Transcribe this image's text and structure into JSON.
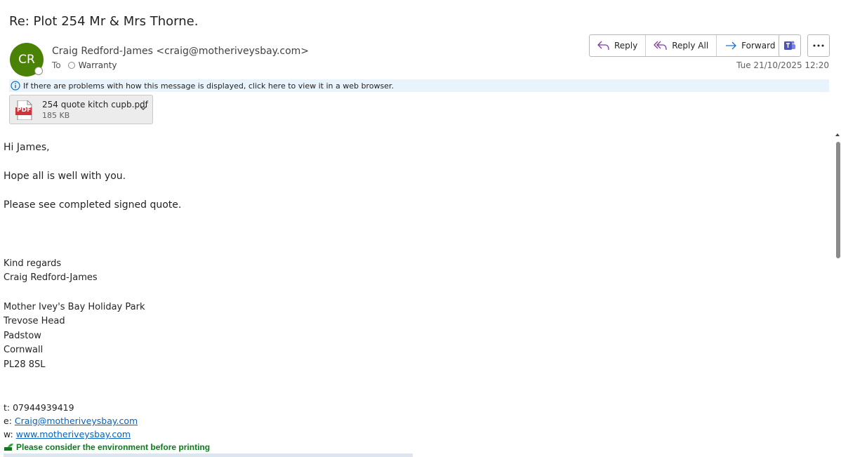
{
  "message": {
    "subject": "Re: Plot 254 Mr & Mrs Thorne.",
    "sender_initials": "CR",
    "sender": "Craig Redford-James <craig@motheriveysbay.com>",
    "to_label": "To",
    "recipient": "Warranty",
    "date": "Tue 21/10/2025 12:20",
    "info_bar": "If there are problems with how this message is displayed, click here to view it in a web browser."
  },
  "actions": {
    "reply": "Reply",
    "reply_all": "Reply All",
    "forward": "Forward"
  },
  "attachment": {
    "type_label": "PDF",
    "name": "254 quote kitch cupb.pdf",
    "size": "185 KB"
  },
  "body": {
    "greeting": "Hi James,",
    "line1": "Hope all is well with you.",
    "line2": "Please see completed signed quote."
  },
  "signature": {
    "sign_off": "Kind regards",
    "name": "Craig Redford-James",
    "address": [
      "Mother Ivey's Bay Holiday Park",
      "Trevose Head",
      "Padstow",
      "Cornwall",
      "PL28 8SL"
    ],
    "phone": "t: 07944939419",
    "email_prefix": "e: ",
    "email": "Craig@motheriveysbay.com",
    "web_prefix": "w: ",
    "web": "www.motheriveysbay.com",
    "env_note": "Please consider the environment before printing"
  },
  "colors": {
    "avatar": "#498205",
    "link": "#0563c1",
    "env_note": "#0a7c1a",
    "info_bar": "#e8f3fb"
  }
}
